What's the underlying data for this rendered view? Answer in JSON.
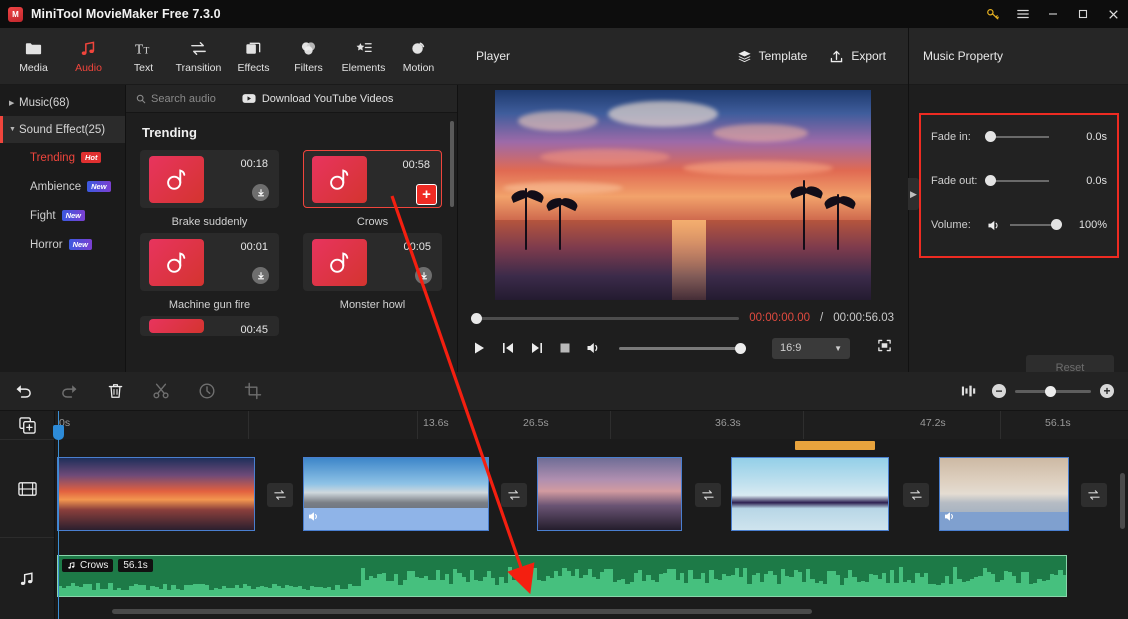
{
  "titlebar": {
    "app_name": "MiniTool MovieMaker Free 7.3.0",
    "logo_text": "M",
    "key_icon": "key-icon",
    "menu_icon": "hamburger-menu-icon",
    "minimize": "minimize-icon",
    "maximize": "maximize-icon",
    "close": "close-icon"
  },
  "toolbar": {
    "items": [
      {
        "label": "Media",
        "icon": "folder-icon",
        "active": false
      },
      {
        "label": "Audio",
        "icon": "music-note-icon",
        "active": true
      },
      {
        "label": "Text",
        "icon": "text-icon",
        "active": false
      },
      {
        "label": "Transition",
        "icon": "transition-icon",
        "active": false
      },
      {
        "label": "Effects",
        "icon": "effects-icon",
        "active": false
      },
      {
        "label": "Filters",
        "icon": "filters-icon",
        "active": false
      },
      {
        "label": "Elements",
        "icon": "elements-icon",
        "active": false
      },
      {
        "label": "Motion",
        "icon": "motion-icon",
        "active": false
      }
    ]
  },
  "sidebar": {
    "groups": [
      {
        "label": "Music(68)",
        "expanded": false,
        "selected": false
      },
      {
        "label": "Sound Effect(25)",
        "expanded": true,
        "selected": true
      }
    ],
    "items": [
      {
        "label": "Trending",
        "badge": "Hot",
        "badge_type": "hot",
        "active": true
      },
      {
        "label": "Ambience",
        "badge": "New",
        "badge_type": "new",
        "active": false
      },
      {
        "label": "Fight",
        "badge": "New",
        "badge_type": "new",
        "active": false
      },
      {
        "label": "Horror",
        "badge": "New",
        "badge_type": "new",
        "active": false
      }
    ]
  },
  "library": {
    "search_placeholder": "Search audio",
    "search_icon": "search-icon",
    "youtube_label": "Download YouTube Videos",
    "youtube_icon": "youtube-download-icon",
    "section_title": "Trending",
    "cards": [
      {
        "name": "Brake suddenly",
        "duration": "00:18",
        "selected": false,
        "action": "download"
      },
      {
        "name": "Crows",
        "duration": "00:58",
        "selected": true,
        "action": "add"
      },
      {
        "name": "Machine gun fire",
        "duration": "00:01",
        "selected": false,
        "action": "download"
      },
      {
        "name": "Monster howl",
        "duration": "00:05",
        "selected": false,
        "action": "download"
      },
      {
        "name": "",
        "duration": "00:45",
        "selected": false,
        "action": "download"
      }
    ]
  },
  "player": {
    "title": "Player",
    "template_label": "Template",
    "template_icon": "layers-icon",
    "export_label": "Export",
    "export_icon": "upload-icon",
    "current_time": "00:00:00.00",
    "time_separator": "/",
    "total_time": "00:00:56.03",
    "aspect_ratio": "16:9",
    "play_icon": "play-icon",
    "prev_icon": "previous-frame-icon",
    "next_icon": "next-frame-icon",
    "stop_icon": "stop-icon",
    "volume_icon": "volume-icon",
    "fullscreen_icon": "fullscreen-icon",
    "volume_percent": 100,
    "seek_percent": 0
  },
  "property": {
    "title": "Music Property",
    "rows": [
      {
        "label": "Fade in:",
        "value": "0.0s",
        "slider_percent": 0
      },
      {
        "label": "Fade out:",
        "value": "0.0s",
        "slider_percent": 0
      },
      {
        "label": "Volume:",
        "value": "100%",
        "slider_percent": 100,
        "icon": "volume-icon"
      }
    ],
    "reset_label": "Reset",
    "highlight_color": "#ee2b22",
    "collapse_icon": "chevron-right-icon"
  },
  "timeline_toolbar": {
    "buttons": [
      {
        "name": "undo-button",
        "icon": "undo-icon",
        "enabled": true
      },
      {
        "name": "redo-button",
        "icon": "redo-icon",
        "enabled": false
      },
      {
        "name": "delete-button",
        "icon": "trash-icon",
        "enabled": true
      },
      {
        "name": "split-button",
        "icon": "scissors-icon",
        "enabled": false
      },
      {
        "name": "speed-button",
        "icon": "speed-icon",
        "enabled": false
      },
      {
        "name": "crop-button",
        "icon": "crop-icon",
        "enabled": false
      }
    ],
    "fit_icon": "fit-timeline-icon",
    "zoom_out_icon": "zoom-out-icon",
    "zoom_in_icon": "zoom-in-icon",
    "zoom_percent": 40
  },
  "timeline": {
    "track_head_icons": [
      "add-media-icon",
      "video-track-icon",
      "audio-track-icon"
    ],
    "ruler_ticks": [
      "0s",
      "13.6s",
      "26.5s",
      "36.3s",
      "47.2s",
      "56.1s"
    ],
    "playhead_position": "0s",
    "video_clips": [
      {
        "name": "sunset-beach-clip",
        "has_audio": false
      },
      {
        "name": "city-mountain-clip",
        "has_audio": true
      },
      {
        "name": "lake-sunset-clip",
        "has_audio": false
      },
      {
        "name": "pier-sky-clip",
        "has_audio": false
      },
      {
        "name": "dawn-water-clip",
        "has_audio": true
      }
    ],
    "transition_icon": "transition-swap-icon",
    "audio_clip": {
      "name": "Crows",
      "duration": "56.1s",
      "icon": "music-note-icon",
      "color": "#1d7a47"
    }
  }
}
